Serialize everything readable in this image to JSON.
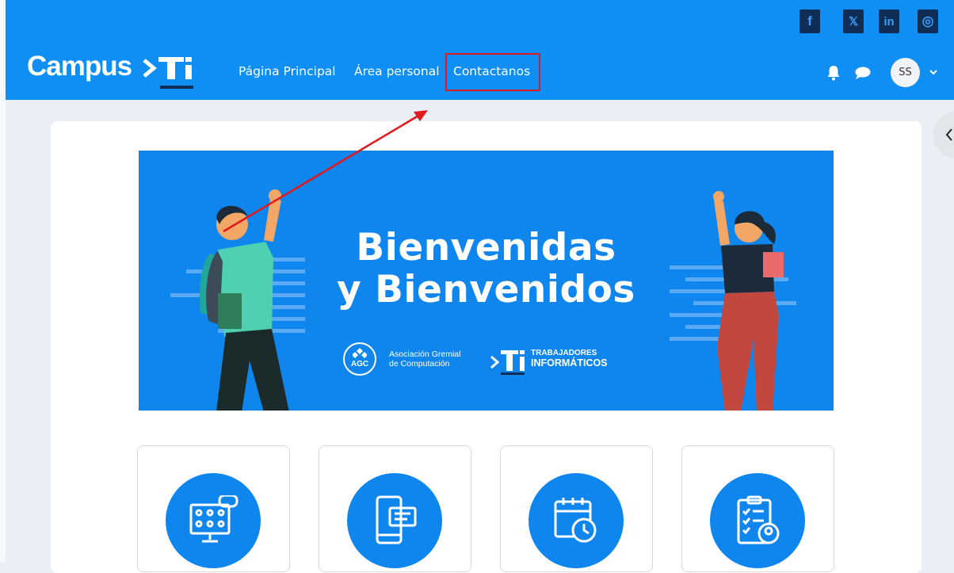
{
  "header": {
    "logo_text": "Campus",
    "logo_mark_text": "Ti",
    "nav": [
      {
        "label": "Página Principal"
      },
      {
        "label": "Área personal"
      },
      {
        "label": "Contactanos"
      }
    ],
    "avatar_initials": "SS",
    "social": [
      {
        "icon": "facebook-icon",
        "glyph": "f"
      },
      {
        "icon": "x-icon",
        "glyph": "𝕏"
      },
      {
        "icon": "linkedin-icon",
        "glyph": "in"
      },
      {
        "icon": "instagram-icon",
        "glyph": "◎"
      }
    ]
  },
  "banner": {
    "title_line1": "Bienvenidas",
    "title_line2": "y Bienvenidos",
    "agc_badge": "AGC",
    "agc_line1": "Asociación Gremial",
    "agc_line2": "de Computación",
    "ti_line1": "TRABAJADORES",
    "ti_line2": "INFORMÁTICOS"
  },
  "cards": [
    {
      "icon": "video-conference-icon"
    },
    {
      "icon": "mobile-chat-icon"
    },
    {
      "icon": "calendar-clock-icon"
    },
    {
      "icon": "clipboard-checklist-icon"
    }
  ],
  "colors": {
    "brand_blue": "#0f8ef4",
    "highlight_red": "#e0191e",
    "social_bg": "#0f2d55"
  }
}
